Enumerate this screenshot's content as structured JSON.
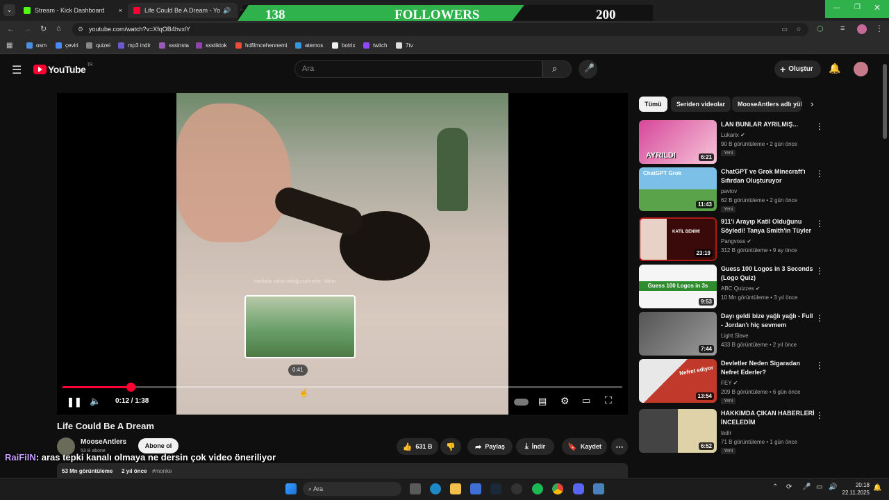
{
  "browser": {
    "tabs": [
      {
        "label": "Stream - Kick Dashboard",
        "favicon_color": "#53fc18"
      },
      {
        "label": "Life Could Be A Dream - Yo",
        "favicon_color": "#ff0033"
      }
    ],
    "url": "youtube.com/watch?v=XfqOB4hvxlY",
    "bookmarks": [
      {
        "label": "osm",
        "color": "#4a90e2"
      },
      {
        "label": "çeviri",
        "color": "#4a8af4"
      },
      {
        "label": "quizei",
        "color": "#888888"
      },
      {
        "label": "mp3 indir",
        "color": "#6a5acd"
      },
      {
        "label": "sssinsta",
        "color": "#9b59b6"
      },
      {
        "label": "ssstiktok",
        "color": "#8e44ad"
      },
      {
        "label": "hdfilmcehennemi",
        "color": "#e74c3c"
      },
      {
        "label": "atemos",
        "color": "#3498db"
      },
      {
        "label": "botrix",
        "color": "#ecf0f1"
      },
      {
        "label": "twitch",
        "color": "#9146ff"
      },
      {
        "label": "7tv",
        "color": "#dddddd"
      }
    ]
  },
  "stream_overlay": {
    "followers_current": "138",
    "followers_label": "FOLLOWERS",
    "followers_goal": "200",
    "color": "#2fb24c"
  },
  "youtube": {
    "logo_text": "YouTube",
    "logo_region": "TR",
    "search_placeholder": "Ara",
    "create_label": "Oluştur",
    "player": {
      "current_time": "0:12",
      "total_time": "1:38",
      "time_display": "0:12 / 1:38",
      "progress_fraction": 0.122,
      "hover_time": "0:41",
      "subtitle_hint": "Haklarla sahip olduğu sahneler: Vakar"
    },
    "video": {
      "title": "Life Could Be A Dream",
      "channel": "MooseAntlers",
      "subscribers": "53 B abone",
      "subscribe_label": "Abone ol",
      "likes": "631 B",
      "share_label": "Paylaş",
      "download_label": "İndir",
      "save_label": "Kaydet",
      "views": "53 Mn görüntüleme",
      "age": "2 yıl önce",
      "tag": "#monke"
    },
    "chips": [
      "Tümü",
      "Seriden videolar",
      "MooseAntlers adlı yüklen"
    ],
    "recommendations": [
      {
        "title": "LAN BUNLAR AYRILMIŞ...",
        "channel": "Lukarix",
        "verified": true,
        "meta": "90 B görüntüleme • 2 gün önce",
        "new": "Yeni",
        "duration": "6:21",
        "thumb_text": "AYRILDI",
        "c1": "#d6479b",
        "c2": "#f7c6d8"
      },
      {
        "title": "ChatGPT ve Grok Minecraft'ı Sıfırdan Oluşturuyor",
        "channel": "pavlov",
        "verified": false,
        "meta": "62 B görüntüleme • 2 gün önce",
        "new": "Yeni",
        "duration": "11:43",
        "thumb_text": "ChatGPT  Grok",
        "c1": "#7cc0e8",
        "c2": "#5aa34a"
      },
      {
        "title": "911'i Arayıp Katil Olduğunu Söyledi! Tanya Smith'in Tüyler ...",
        "channel": "Pangvoss",
        "verified": true,
        "meta": "312 B görüntüleme • 9 ay önce",
        "new": "",
        "duration": "23:19",
        "thumb_text": "KATİL BENİM!",
        "c1": "#3a0a0a",
        "c2": "#b01818"
      },
      {
        "title": "Guess 100 Logos in 3 Seconds (Logo Quiz)",
        "channel": "ABC Quizzes",
        "verified": true,
        "meta": "10 Mn görüntüleme • 3 yıl önce",
        "new": "",
        "duration": "9:53",
        "thumb_text": "Guess 100 Logos in 3s",
        "c1": "#f5f5f5",
        "c2": "#2e8b2e"
      },
      {
        "title": "Dayı geldi bize yağlı yağlı - Full - Jordan'ı hiç sevmem",
        "channel": "Light Slave",
        "verified": false,
        "meta": "433 B görüntüleme • 2 yıl önce",
        "new": "",
        "duration": "7:44",
        "thumb_text": "",
        "c1": "#555555",
        "c2": "#9a9a9a"
      },
      {
        "title": "Devletler Neden Sigaradan Nefret Ederler?",
        "channel": "FEY",
        "verified": true,
        "meta": "209 B görüntüleme • 6 gün önce",
        "new": "Yeni",
        "duration": "13:54",
        "thumb_text": "Nefret ediyor",
        "c1": "#c0392b",
        "c2": "#e8e8e8"
      },
      {
        "title": "HAKKIMDA ÇIKAN HABERLERİ İNCELEDİM",
        "channel": "ladir",
        "verified": false,
        "meta": "71 B görüntüleme • 1 gün önce",
        "new": "Yeni",
        "duration": "6:52",
        "thumb_text": "",
        "c1": "#444444",
        "c2": "#e0d2a8"
      }
    ]
  },
  "chat_overlay": {
    "user": "RaiFiIN",
    "message": ": aras tepki kanalı olmaya ne dersin çok video öneriliyor"
  },
  "taskbar": {
    "search_placeholder": "Ara",
    "time": "20:18",
    "date": "22.11.2025"
  }
}
